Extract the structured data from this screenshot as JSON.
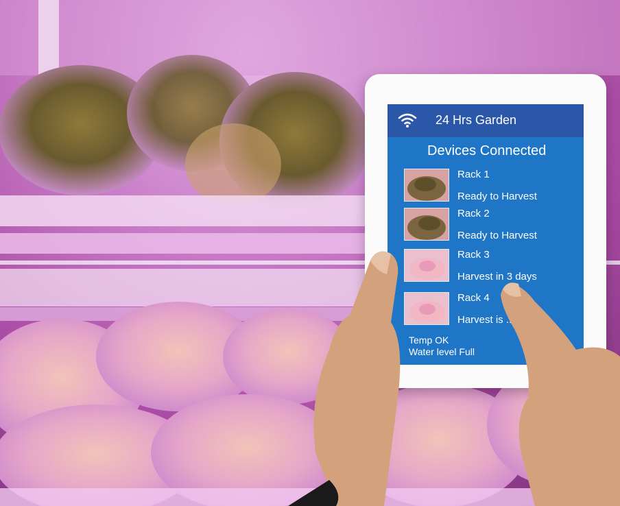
{
  "app": {
    "title": "24 Hrs Garden",
    "subtitle": "Devices Connected"
  },
  "racks": [
    {
      "name": "Rack 1",
      "status": "Ready to Harvest"
    },
    {
      "name": "Rack 2",
      "status": "Ready to Harvest"
    },
    {
      "name": "Rack 3",
      "status": "Harvest in 3 days"
    },
    {
      "name": "Rack 4",
      "status": "Harvest is ..."
    }
  ],
  "status": {
    "temp": "Temp OK",
    "water": "Water level Full"
  },
  "icons": {
    "wifi": "wifi-icon",
    "prev": "chevron-left-icon",
    "next": "chevron-right-icon"
  },
  "colors": {
    "topbar": "#2b57a9",
    "screen": "#1f76c7",
    "grow_light": "#c77ac6"
  }
}
